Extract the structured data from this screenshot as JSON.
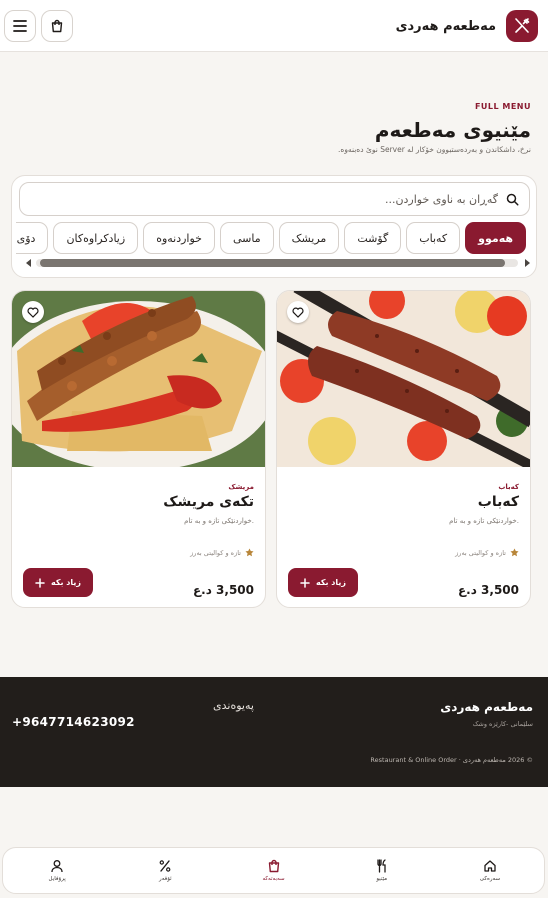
{
  "header": {
    "brand_name": "مەطعەم هەردی",
    "icons": {
      "logo": "fork-knife-icon",
      "cart": "shopping-bag-icon",
      "menu": "hamburger-icon"
    }
  },
  "hero": {
    "eyebrow": "FULL MENU",
    "title": "مێنیوی مەطعەم",
    "subtitle": "نرخ، داشکاندن و بەردەستبوون خۆکار لە Server نوێ دەبنەوە."
  },
  "search": {
    "placeholder": "گەڕان بە ناوی خواردن..."
  },
  "categories": [
    {
      "label": "هەموو",
      "active": true
    },
    {
      "label": "کەباب",
      "active": false
    },
    {
      "label": "گۆشت",
      "active": false
    },
    {
      "label": "مریشک",
      "active": false
    },
    {
      "label": "ماسی",
      "active": false
    },
    {
      "label": "خواردنەوە",
      "active": false
    },
    {
      "label": "زیادکراوەکان",
      "active": false
    },
    {
      "label": "دۆی کوردی",
      "active": false
    }
  ],
  "products": [
    {
      "category": "کەباب",
      "name": "کەباب",
      "description": "خواردنێکی تازە و بە تام.",
      "tag": "تازە و کوالیتی بەرز",
      "price": "3,500 د.ع",
      "add_label": "زیاد بکە"
    },
    {
      "category": "مریشک",
      "name": "تکەی مریشک",
      "description": "خواردنێکی تازە و بە تام.",
      "tag": "تازە و کوالیتی بەرز",
      "price": "3,500 د.ع",
      "add_label": "زیاد بکە"
    }
  ],
  "footer": {
    "brand": "مەطعەم هەردی",
    "location": "سلێمانی -کارێزە وشک",
    "contact_title": "پەیوەندی",
    "phone": "+9647714623092",
    "copyright": "© 2026 مەطعەم هەردی · Restaurant & Online Order"
  },
  "bottom_nav": [
    {
      "label": "سەرەکی",
      "icon": "home-icon",
      "active": false
    },
    {
      "label": "مێنیو",
      "icon": "fork-knife-icon",
      "active": false
    },
    {
      "label": "سەبەتەکە",
      "icon": "shopping-bag-icon",
      "active": true
    },
    {
      "label": "ئۆفەر",
      "icon": "percent-icon",
      "active": false
    },
    {
      "label": "پرۆفایل",
      "icon": "user-icon",
      "active": false
    }
  ],
  "colors": {
    "accent": "#8a1a30",
    "background": "#f7f5f2",
    "footer": "#221e1b"
  }
}
